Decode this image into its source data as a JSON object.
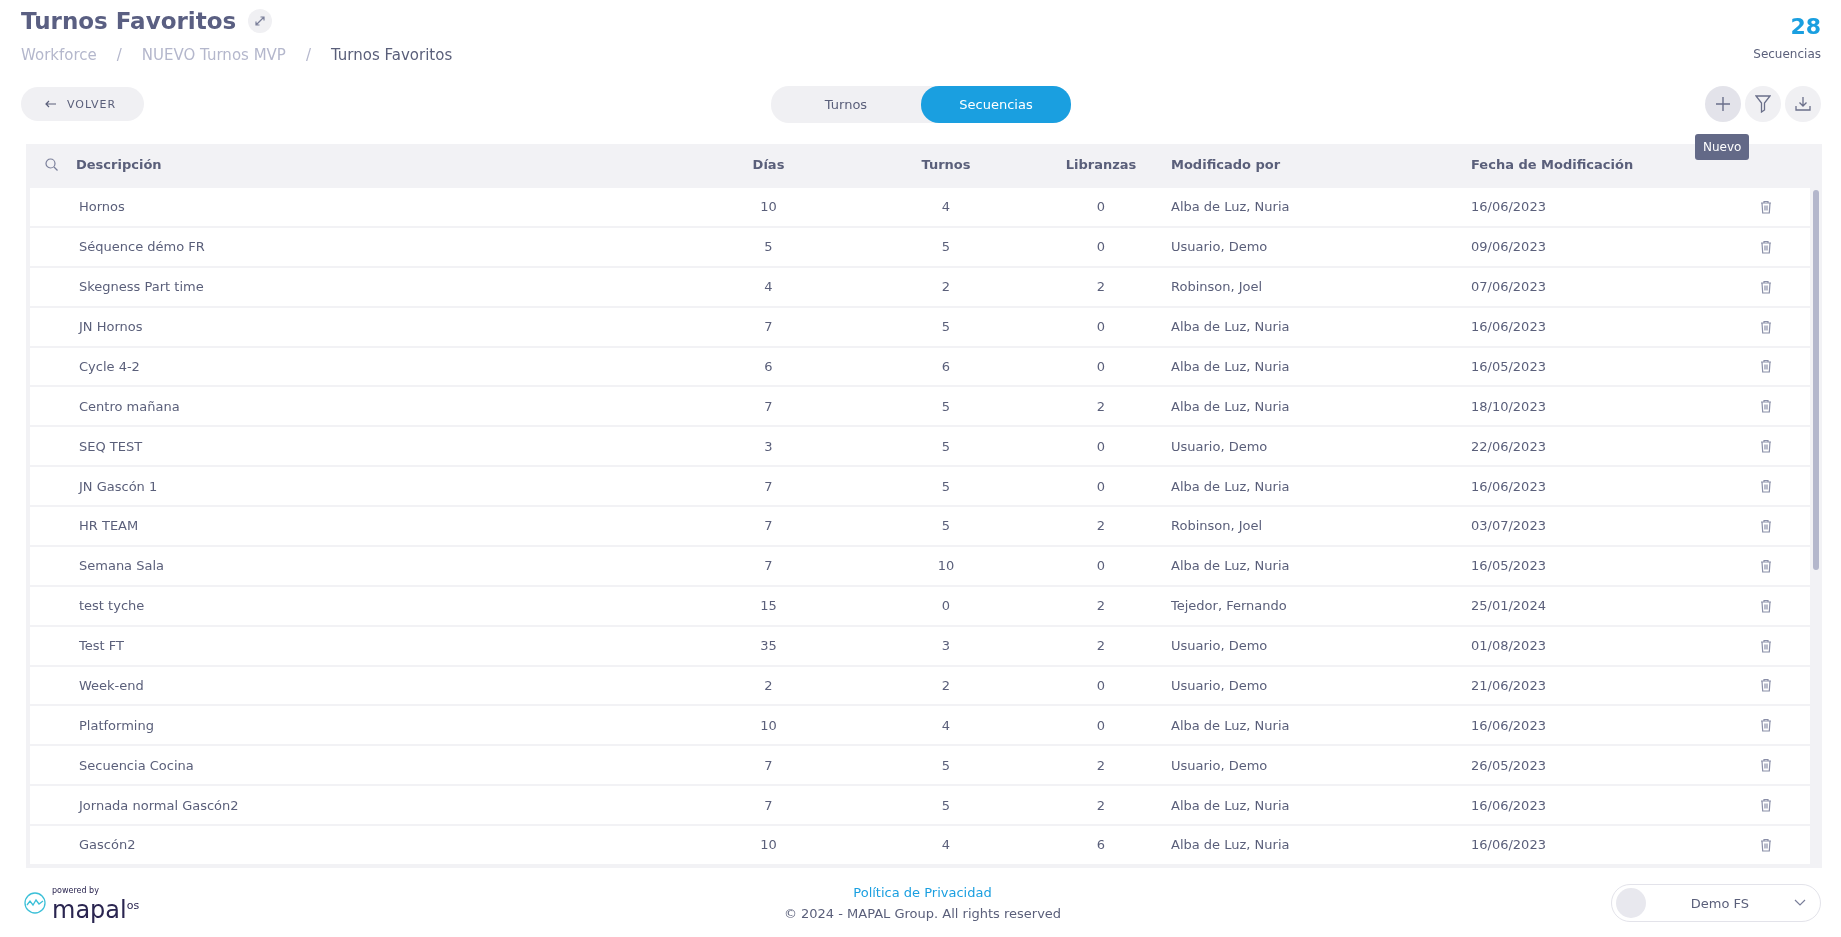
{
  "header": {
    "title": "Turnos Favoritos",
    "breadcrumb": [
      "Workforce",
      "NUEVO Turnos MVP",
      "Turnos Favoritos"
    ],
    "breadcrumb_separator": "/",
    "count": "28",
    "count_label": "Secuencias"
  },
  "back_button": "VOLVER",
  "tabs": [
    {
      "label": "Turnos",
      "selected": false
    },
    {
      "label": "Secuencias",
      "selected": true
    }
  ],
  "tooltip": "Nuevo",
  "table": {
    "columns": [
      "Descripción",
      "Días",
      "Turnos",
      "Libranzas",
      "Modificado por",
      "Fecha de Modificación"
    ],
    "rows": [
      [
        "Hornos",
        "10",
        "4",
        "0",
        "Alba de Luz, Nuria",
        "16/06/2023"
      ],
      [
        "Séquence démo FR",
        "5",
        "5",
        "0",
        "Usuario, Demo",
        "09/06/2023"
      ],
      [
        "Skegness Part time",
        "4",
        "2",
        "2",
        "Robinson, Joel",
        "07/06/2023"
      ],
      [
        "JN Hornos",
        "7",
        "5",
        "0",
        "Alba de Luz, Nuria",
        "16/06/2023"
      ],
      [
        "Cycle 4-2",
        "6",
        "6",
        "0",
        "Alba de Luz, Nuria",
        "16/05/2023"
      ],
      [
        "Centro mañana",
        "7",
        "5",
        "2",
        "Alba de Luz, Nuria",
        "18/10/2023"
      ],
      [
        "SEQ TEST",
        "3",
        "5",
        "0",
        "Usuario, Demo",
        "22/06/2023"
      ],
      [
        "JN Gascón 1",
        "7",
        "5",
        "0",
        "Alba de Luz, Nuria",
        "16/06/2023"
      ],
      [
        "HR TEAM",
        "7",
        "5",
        "2",
        "Robinson, Joel",
        "03/07/2023"
      ],
      [
        "Semana Sala",
        "7",
        "10",
        "0",
        "Alba de Luz, Nuria",
        "16/05/2023"
      ],
      [
        "test tyche",
        "15",
        "0",
        "2",
        "Tejedor, Fernando",
        "25/01/2024"
      ],
      [
        "Test FT",
        "35",
        "3",
        "2",
        "Usuario, Demo",
        "01/08/2023"
      ],
      [
        "Week-end",
        "2",
        "2",
        "0",
        "Usuario, Demo",
        "21/06/2023"
      ],
      [
        "Platforming",
        "10",
        "4",
        "0",
        "Alba de Luz, Nuria",
        "16/06/2023"
      ],
      [
        "Secuencia Cocina",
        "7",
        "5",
        "2",
        "Usuario, Demo",
        "26/05/2023"
      ],
      [
        "Jornada normal Gascón2",
        "7",
        "5",
        "2",
        "Alba de Luz, Nuria",
        "16/06/2023"
      ],
      [
        "Gascón2",
        "10",
        "4",
        "6",
        "Alba de Luz, Nuria",
        "16/06/2023"
      ]
    ]
  },
  "footer": {
    "powered_by": "powered by",
    "logo": "mapal",
    "logo_suffix": "os",
    "privacy_link": "Política de Privacidad",
    "copyright": "© 2024 - MAPAL Group. All rights reserved",
    "account": "Demo FS"
  }
}
